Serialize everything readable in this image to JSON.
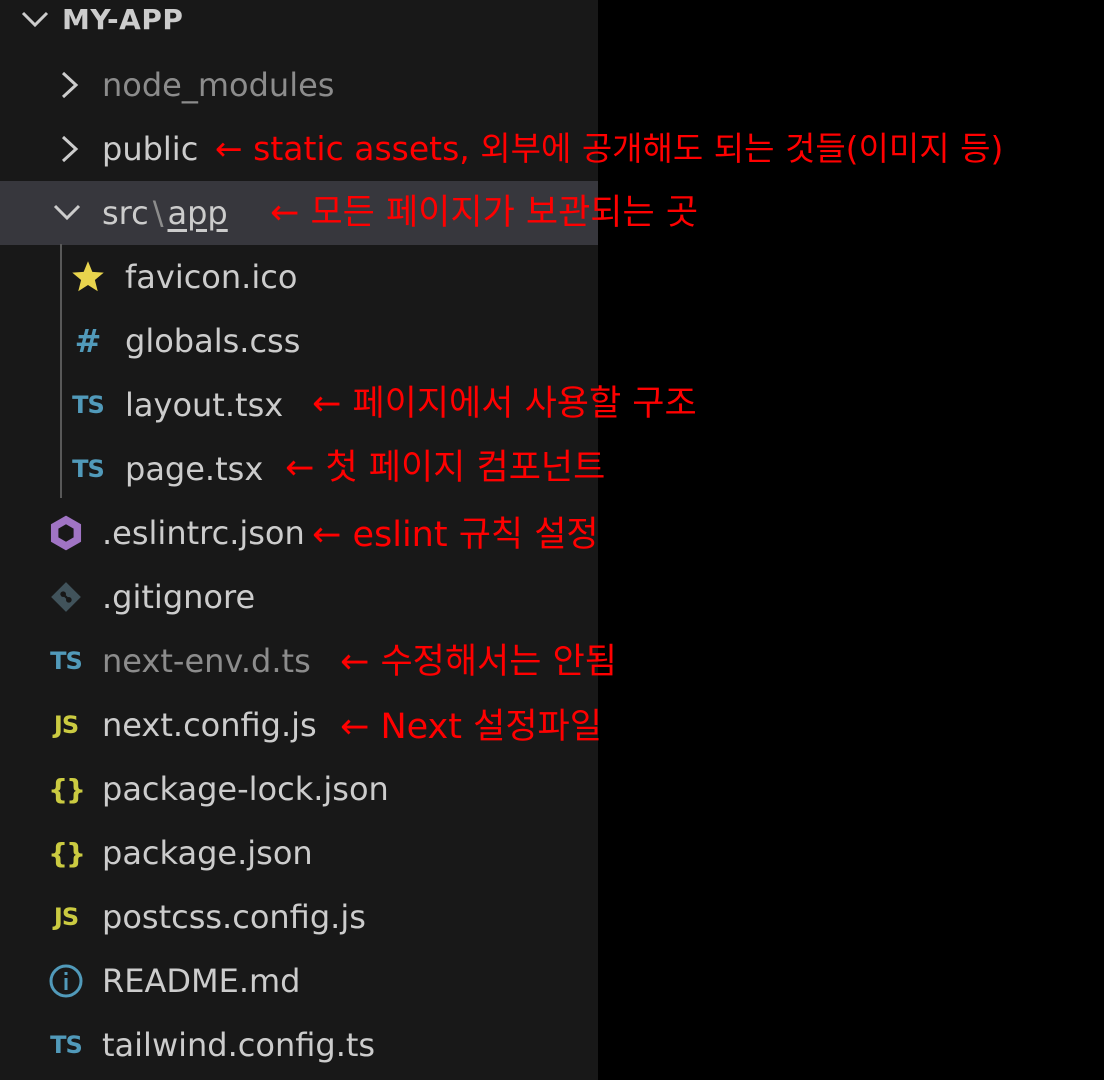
{
  "explorer": {
    "root": "MY-APP",
    "items": [
      {
        "label": "node_modules",
        "kind": "folder",
        "state": "collapsed",
        "icon": "chevron-right-icon"
      },
      {
        "label": "public",
        "kind": "folder",
        "state": "collapsed",
        "icon": "chevron-right-icon"
      },
      {
        "label": "src",
        "separator": "\\",
        "label2": "app",
        "kind": "folder",
        "state": "expanded",
        "icon": "chevron-down-icon"
      },
      {
        "label": "favicon.ico",
        "icon": "star-icon"
      },
      {
        "label": "globals.css",
        "icon": "css-hash-icon",
        "glyph": "#"
      },
      {
        "label": "layout.tsx",
        "icon": "typescript-icon",
        "glyph": "TS"
      },
      {
        "label": "page.tsx",
        "icon": "typescript-icon",
        "glyph": "TS"
      },
      {
        "label": ".eslintrc.json",
        "icon": "eslint-icon"
      },
      {
        "label": ".gitignore",
        "icon": "git-icon"
      },
      {
        "label": "next-env.d.ts",
        "icon": "typescript-icon",
        "glyph": "TS"
      },
      {
        "label": "next.config.js",
        "icon": "javascript-icon",
        "glyph": "JS"
      },
      {
        "label": "package-lock.json",
        "icon": "json-icon",
        "glyph": "{}"
      },
      {
        "label": "package.json",
        "icon": "json-icon",
        "glyph": "{}"
      },
      {
        "label": "postcss.config.js",
        "icon": "javascript-icon",
        "glyph": "JS"
      },
      {
        "label": "README.md",
        "icon": "info-icon"
      },
      {
        "label": "tailwind.config.ts",
        "icon": "typescript-icon",
        "glyph": "TS"
      }
    ]
  },
  "annotations": {
    "public": "← static assets, 외부에 공개해도 되는 것들(이미지 등)",
    "src_app": "← 모든 페이지가 보관되는 곳",
    "layout": "← 페이지에서 사용할 구조",
    "page": "← 첫 페이지 컴포넌트",
    "eslintrc": "← eslint 규칙 설정",
    "next_env": "← 수정해서는 안됨",
    "next_config": "← Next 설정파일"
  },
  "colors": {
    "annotation": "#ff0000",
    "panel": "#181818",
    "selected_row": "#37373d",
    "ts": "#519aba",
    "js": "#cbcb41",
    "eslint": "#a074c4",
    "star": "#e8d44d"
  }
}
